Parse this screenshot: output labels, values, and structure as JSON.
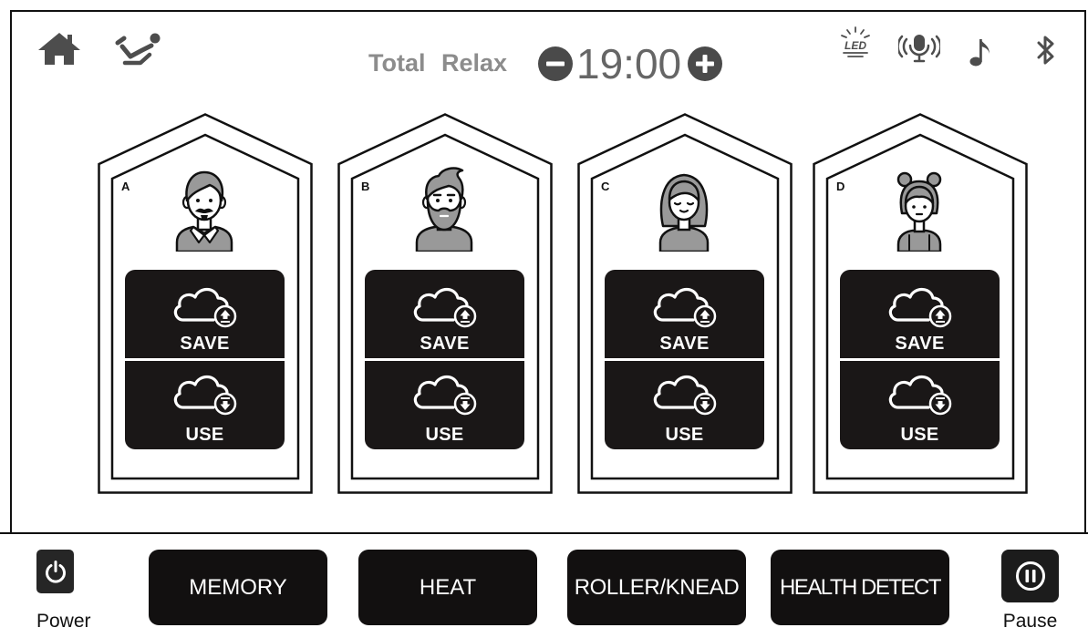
{
  "header": {
    "mode_label": "Total Relax",
    "timer": "19:00",
    "led_text": "LED",
    "left_icons": [
      "home-icon",
      "recline-icon"
    ],
    "timer_icons": [
      "minus-icon",
      "plus-icon"
    ],
    "right_icons": [
      "led-icon",
      "microphone-icon",
      "music-note-icon",
      "bluetooth-icon"
    ]
  },
  "profiles": [
    {
      "letter": "A",
      "avatar": "man-mustache-avatar-icon",
      "save_label": "SAVE",
      "use_label": "USE",
      "save_icon": "cloud-upload-icon",
      "use_icon": "cloud-download-icon"
    },
    {
      "letter": "B",
      "avatar": "bearded-man-avatar-icon",
      "save_label": "SAVE",
      "use_label": "USE",
      "save_icon": "cloud-upload-icon",
      "use_icon": "cloud-download-icon"
    },
    {
      "letter": "C",
      "avatar": "woman-avatar-icon",
      "save_label": "SAVE",
      "use_label": "USE",
      "save_icon": "cloud-upload-icon",
      "use_icon": "cloud-download-icon"
    },
    {
      "letter": "D",
      "avatar": "girl-avatar-icon",
      "save_label": "SAVE",
      "use_label": "USE",
      "save_icon": "cloud-upload-icon",
      "use_icon": "cloud-download-icon"
    }
  ],
  "footer": {
    "power_label": "Power",
    "power_icon": "power-icon",
    "buttons": [
      {
        "label": "MEMORY"
      },
      {
        "label": "HEAT"
      },
      {
        "label": "ROLLER/KNEAD"
      },
      {
        "label": "HEALTH DETECT"
      }
    ],
    "pause_label": "Pause",
    "pause_icon": "pause-icon"
  },
  "colors": {
    "button_bg": "#121010",
    "icon_gray": "#4d4d4d",
    "mode_label_gray": "#8c8c8c",
    "timer_gray": "#666666",
    "avatar_gray": "#999999"
  }
}
